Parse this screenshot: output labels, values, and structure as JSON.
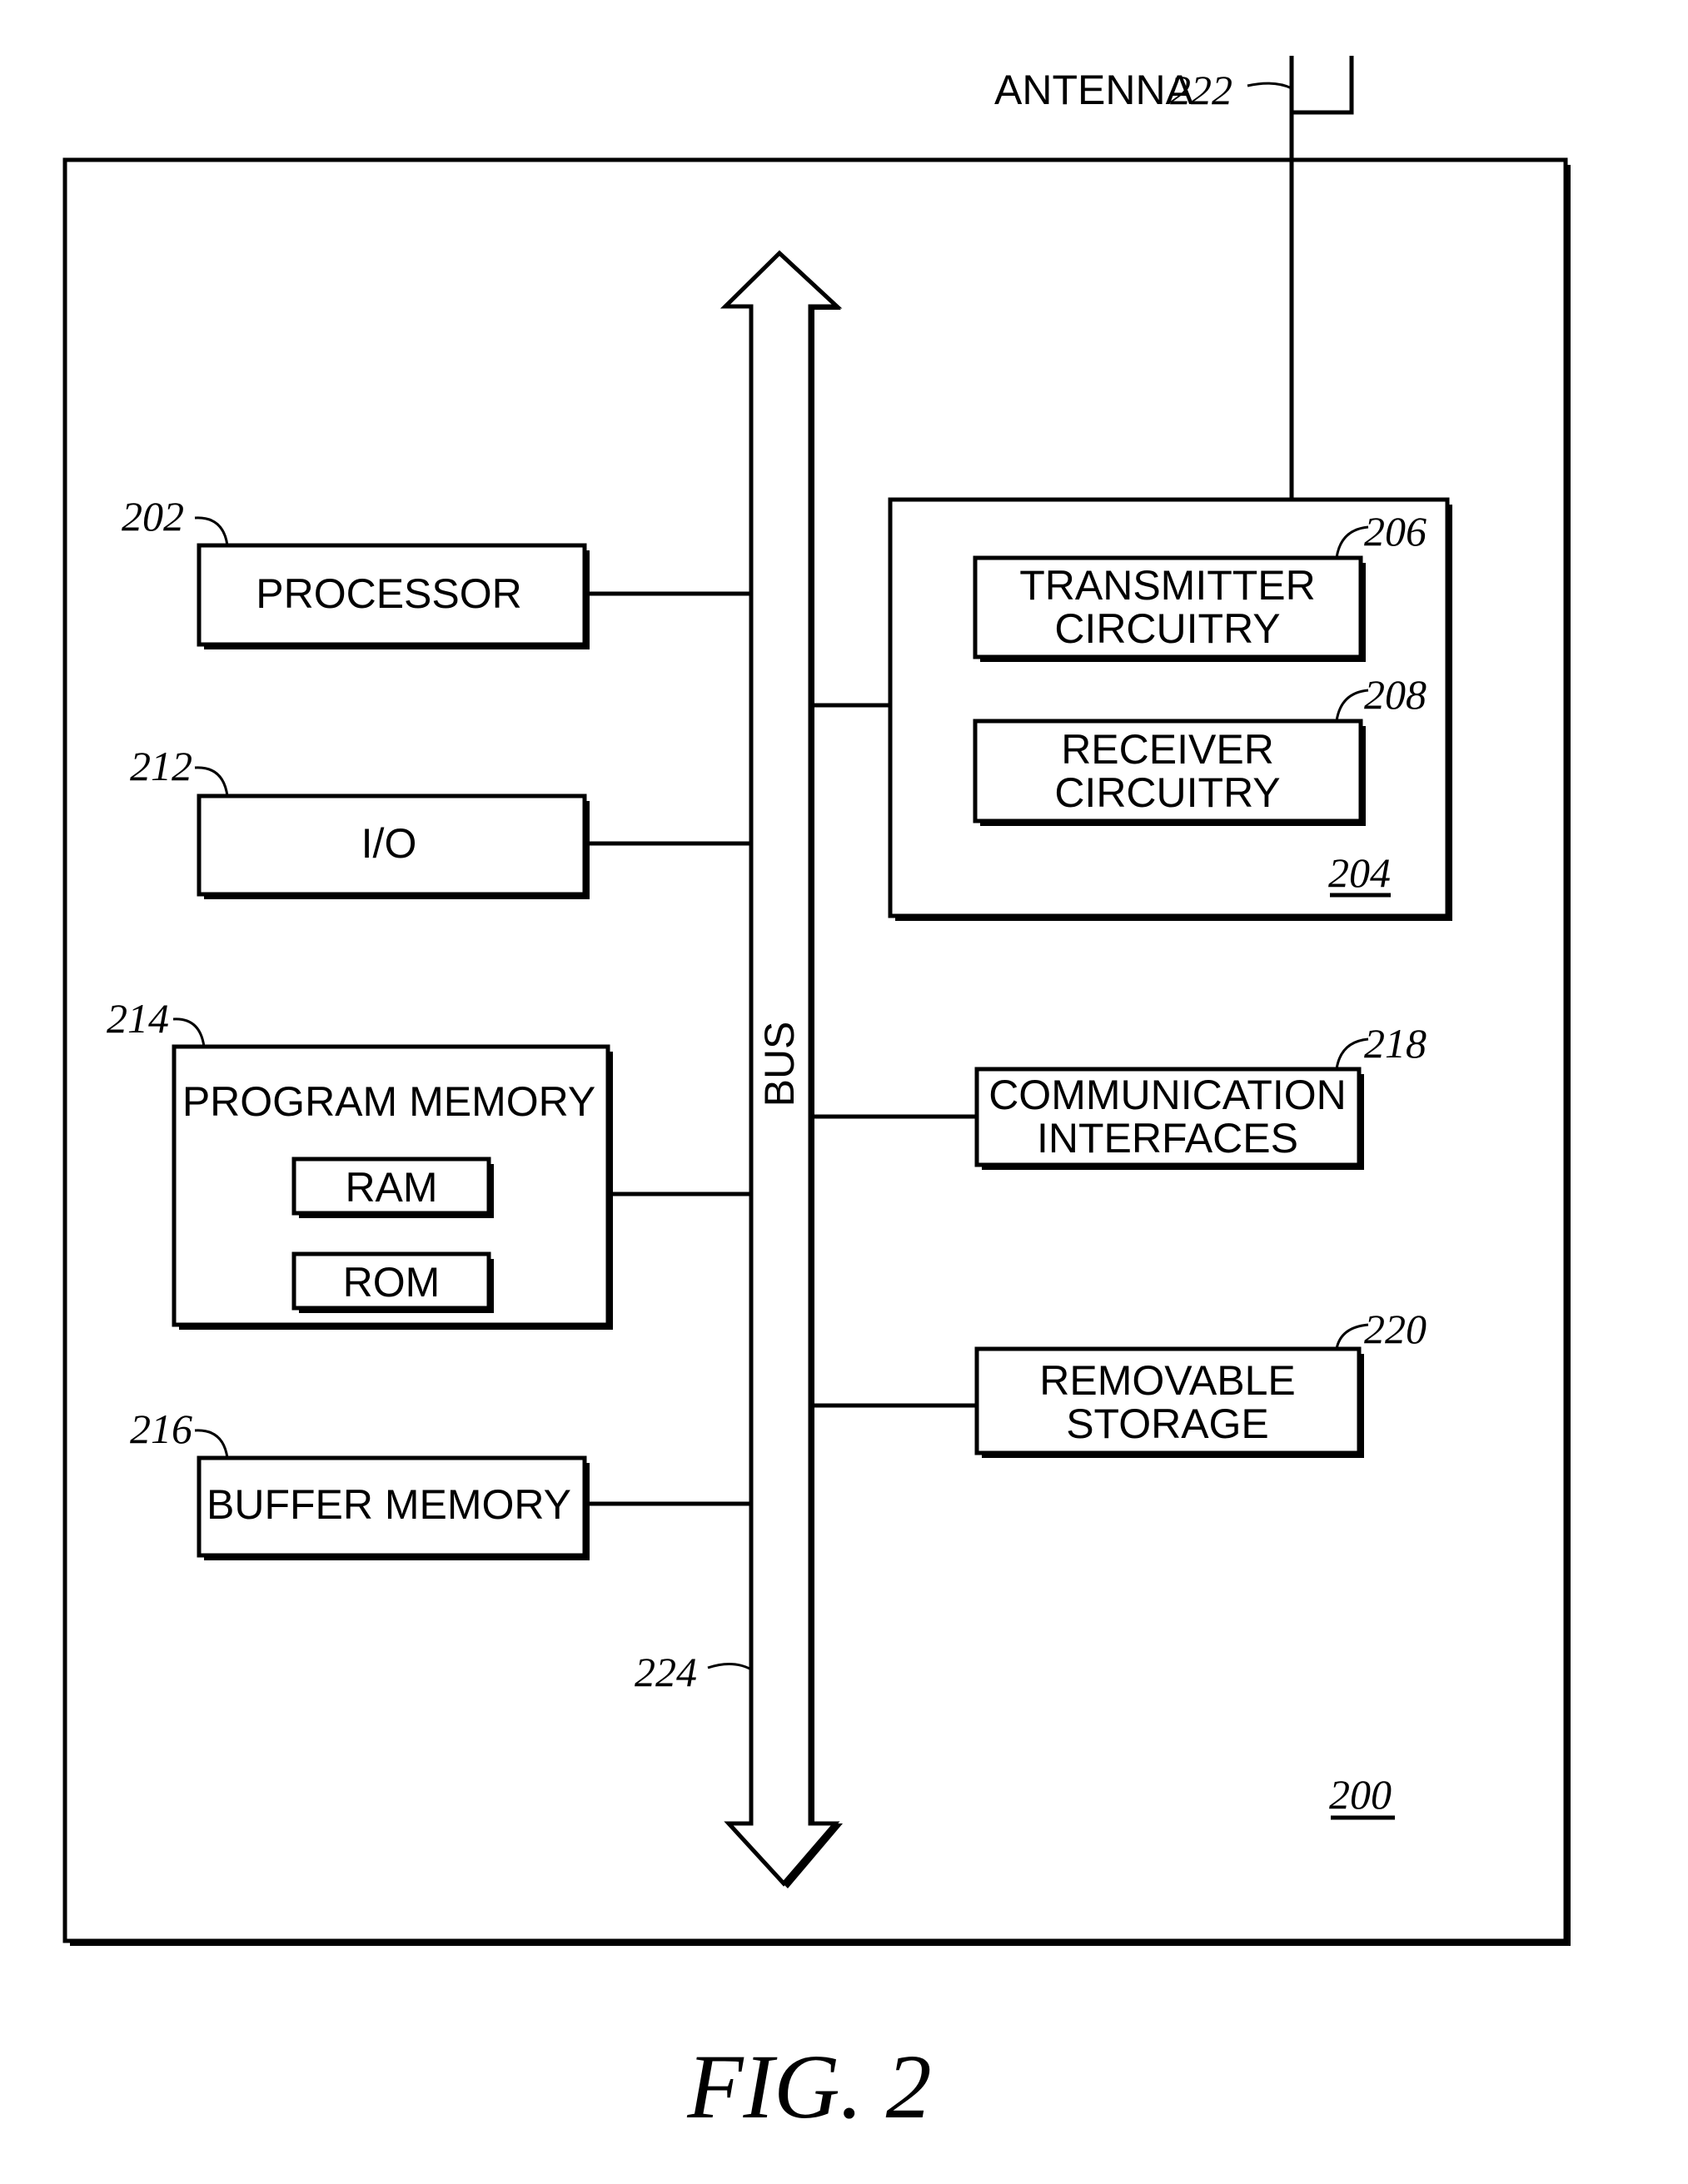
{
  "figure": {
    "caption": "FIG. 2",
    "device_ref": "200"
  },
  "antenna": {
    "label": "ANTENNA",
    "ref": "222"
  },
  "bus": {
    "label": "BUS",
    "ref": "224"
  },
  "left_blocks": [
    {
      "id": "processor",
      "label": "PROCESSOR",
      "ref": "202"
    },
    {
      "id": "io",
      "label": "I/O",
      "ref": "212"
    },
    {
      "id": "program-memory",
      "label": "PROGRAM MEMORY",
      "ref": "214",
      "sub_blocks": [
        "RAM",
        "ROM"
      ]
    },
    {
      "id": "buffer-memory",
      "label": "BUFFER MEMORY",
      "ref": "216"
    }
  ],
  "transceiver": {
    "ref": "204",
    "transmitter": {
      "lines": [
        "TRANSMITTER",
        "CIRCUITRY"
      ],
      "ref": "206"
    },
    "receiver": {
      "lines": [
        "RECEIVER",
        "CIRCUITRY"
      ],
      "ref": "208"
    }
  },
  "right_blocks": [
    {
      "id": "communication-interfaces",
      "lines": [
        "COMMUNICATION",
        "INTERFACES"
      ],
      "ref": "218"
    },
    {
      "id": "removable-storage",
      "lines": [
        "REMOVABLE",
        "STORAGE"
      ],
      "ref": "220"
    }
  ]
}
